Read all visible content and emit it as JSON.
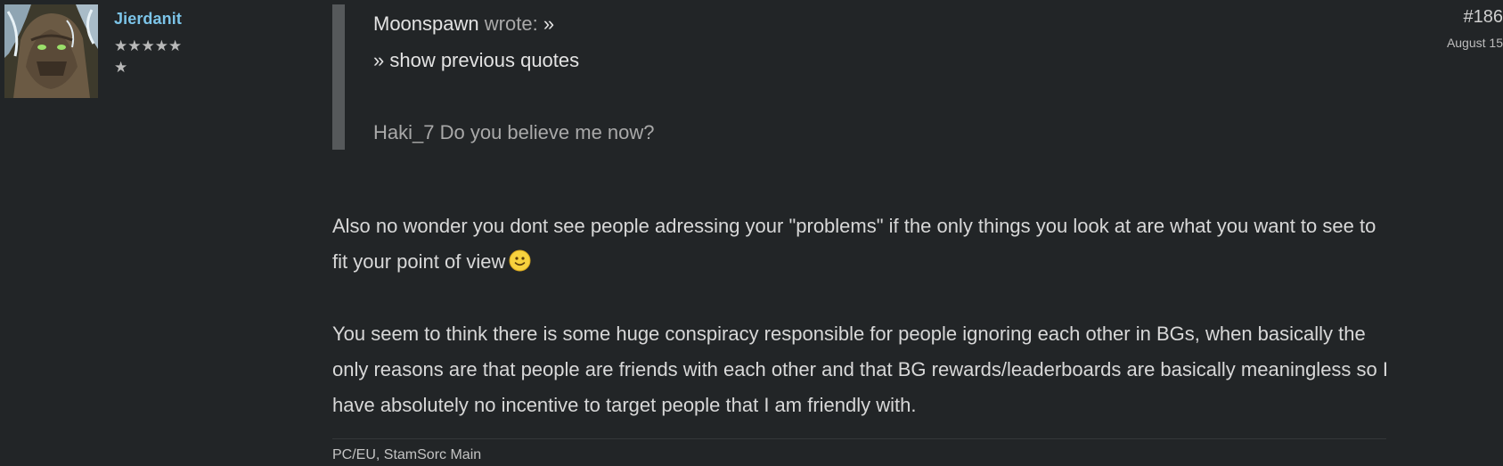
{
  "author": {
    "username": "Jierdanit",
    "rank_stars_row1": "★★★★★",
    "rank_stars_row2": "★"
  },
  "post": {
    "number": "#186",
    "date": "August 15"
  },
  "quote": {
    "author": "Moonspawn",
    "wrote_label": "wrote:",
    "link_glyph": "»",
    "show_previous": "» show previous quotes",
    "text": "Haki_7 Do you believe me now?"
  },
  "body": {
    "paragraph1": "Also no wonder you dont see people adressing your \"problems\" if the only things you look at are what you want to see to fit your point of view",
    "paragraph2": "You seem to think there is some huge conspiracy responsible for people ignoring each other in BGs, when basically the only reasons are that people are friends with each other and that BG rewards/leaderboards are basically meaningless so I have absolutely no incentive to target people that I am friendly with."
  },
  "signature": "PC/EU, StamSorc Main",
  "icons": {
    "smiley": "smiley-emoji-icon",
    "avatar": "user-avatar-image"
  },
  "colors": {
    "background": "#222527",
    "username": "#7cc4e8",
    "quote_bar": "#56595b"
  }
}
